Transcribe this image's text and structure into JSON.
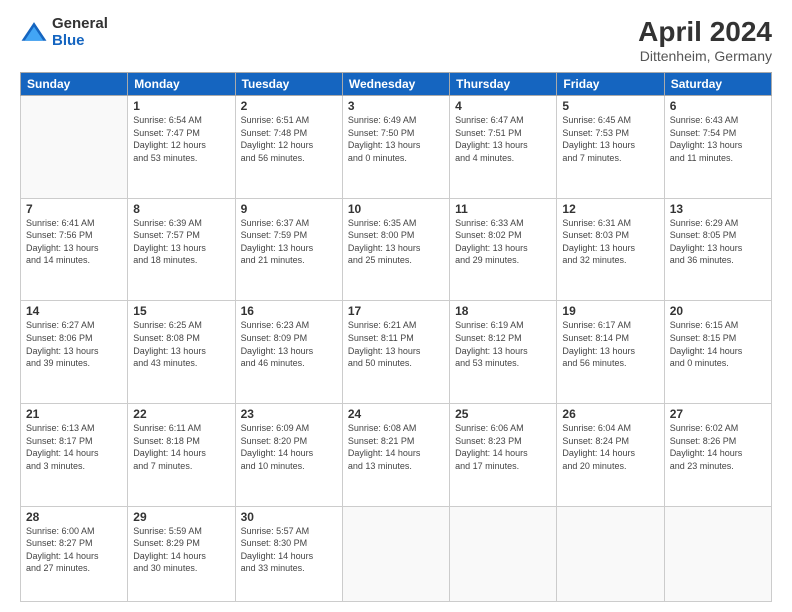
{
  "header": {
    "logo_general": "General",
    "logo_blue": "Blue",
    "title": "April 2024",
    "subtitle": "Dittenheim, Germany"
  },
  "days_of_week": [
    "Sunday",
    "Monday",
    "Tuesday",
    "Wednesday",
    "Thursday",
    "Friday",
    "Saturday"
  ],
  "weeks": [
    [
      {
        "day": "",
        "info": ""
      },
      {
        "day": "1",
        "info": "Sunrise: 6:54 AM\nSunset: 7:47 PM\nDaylight: 12 hours\nand 53 minutes."
      },
      {
        "day": "2",
        "info": "Sunrise: 6:51 AM\nSunset: 7:48 PM\nDaylight: 12 hours\nand 56 minutes."
      },
      {
        "day": "3",
        "info": "Sunrise: 6:49 AM\nSunset: 7:50 PM\nDaylight: 13 hours\nand 0 minutes."
      },
      {
        "day": "4",
        "info": "Sunrise: 6:47 AM\nSunset: 7:51 PM\nDaylight: 13 hours\nand 4 minutes."
      },
      {
        "day": "5",
        "info": "Sunrise: 6:45 AM\nSunset: 7:53 PM\nDaylight: 13 hours\nand 7 minutes."
      },
      {
        "day": "6",
        "info": "Sunrise: 6:43 AM\nSunset: 7:54 PM\nDaylight: 13 hours\nand 11 minutes."
      }
    ],
    [
      {
        "day": "7",
        "info": "Sunrise: 6:41 AM\nSunset: 7:56 PM\nDaylight: 13 hours\nand 14 minutes."
      },
      {
        "day": "8",
        "info": "Sunrise: 6:39 AM\nSunset: 7:57 PM\nDaylight: 13 hours\nand 18 minutes."
      },
      {
        "day": "9",
        "info": "Sunrise: 6:37 AM\nSunset: 7:59 PM\nDaylight: 13 hours\nand 21 minutes."
      },
      {
        "day": "10",
        "info": "Sunrise: 6:35 AM\nSunset: 8:00 PM\nDaylight: 13 hours\nand 25 minutes."
      },
      {
        "day": "11",
        "info": "Sunrise: 6:33 AM\nSunset: 8:02 PM\nDaylight: 13 hours\nand 29 minutes."
      },
      {
        "day": "12",
        "info": "Sunrise: 6:31 AM\nSunset: 8:03 PM\nDaylight: 13 hours\nand 32 minutes."
      },
      {
        "day": "13",
        "info": "Sunrise: 6:29 AM\nSunset: 8:05 PM\nDaylight: 13 hours\nand 36 minutes."
      }
    ],
    [
      {
        "day": "14",
        "info": "Sunrise: 6:27 AM\nSunset: 8:06 PM\nDaylight: 13 hours\nand 39 minutes."
      },
      {
        "day": "15",
        "info": "Sunrise: 6:25 AM\nSunset: 8:08 PM\nDaylight: 13 hours\nand 43 minutes."
      },
      {
        "day": "16",
        "info": "Sunrise: 6:23 AM\nSunset: 8:09 PM\nDaylight: 13 hours\nand 46 minutes."
      },
      {
        "day": "17",
        "info": "Sunrise: 6:21 AM\nSunset: 8:11 PM\nDaylight: 13 hours\nand 50 minutes."
      },
      {
        "day": "18",
        "info": "Sunrise: 6:19 AM\nSunset: 8:12 PM\nDaylight: 13 hours\nand 53 minutes."
      },
      {
        "day": "19",
        "info": "Sunrise: 6:17 AM\nSunset: 8:14 PM\nDaylight: 13 hours\nand 56 minutes."
      },
      {
        "day": "20",
        "info": "Sunrise: 6:15 AM\nSunset: 8:15 PM\nDaylight: 14 hours\nand 0 minutes."
      }
    ],
    [
      {
        "day": "21",
        "info": "Sunrise: 6:13 AM\nSunset: 8:17 PM\nDaylight: 14 hours\nand 3 minutes."
      },
      {
        "day": "22",
        "info": "Sunrise: 6:11 AM\nSunset: 8:18 PM\nDaylight: 14 hours\nand 7 minutes."
      },
      {
        "day": "23",
        "info": "Sunrise: 6:09 AM\nSunset: 8:20 PM\nDaylight: 14 hours\nand 10 minutes."
      },
      {
        "day": "24",
        "info": "Sunrise: 6:08 AM\nSunset: 8:21 PM\nDaylight: 14 hours\nand 13 minutes."
      },
      {
        "day": "25",
        "info": "Sunrise: 6:06 AM\nSunset: 8:23 PM\nDaylight: 14 hours\nand 17 minutes."
      },
      {
        "day": "26",
        "info": "Sunrise: 6:04 AM\nSunset: 8:24 PM\nDaylight: 14 hours\nand 20 minutes."
      },
      {
        "day": "27",
        "info": "Sunrise: 6:02 AM\nSunset: 8:26 PM\nDaylight: 14 hours\nand 23 minutes."
      }
    ],
    [
      {
        "day": "28",
        "info": "Sunrise: 6:00 AM\nSunset: 8:27 PM\nDaylight: 14 hours\nand 27 minutes."
      },
      {
        "day": "29",
        "info": "Sunrise: 5:59 AM\nSunset: 8:29 PM\nDaylight: 14 hours\nand 30 minutes."
      },
      {
        "day": "30",
        "info": "Sunrise: 5:57 AM\nSunset: 8:30 PM\nDaylight: 14 hours\nand 33 minutes."
      },
      {
        "day": "",
        "info": ""
      },
      {
        "day": "",
        "info": ""
      },
      {
        "day": "",
        "info": ""
      },
      {
        "day": "",
        "info": ""
      }
    ]
  ]
}
